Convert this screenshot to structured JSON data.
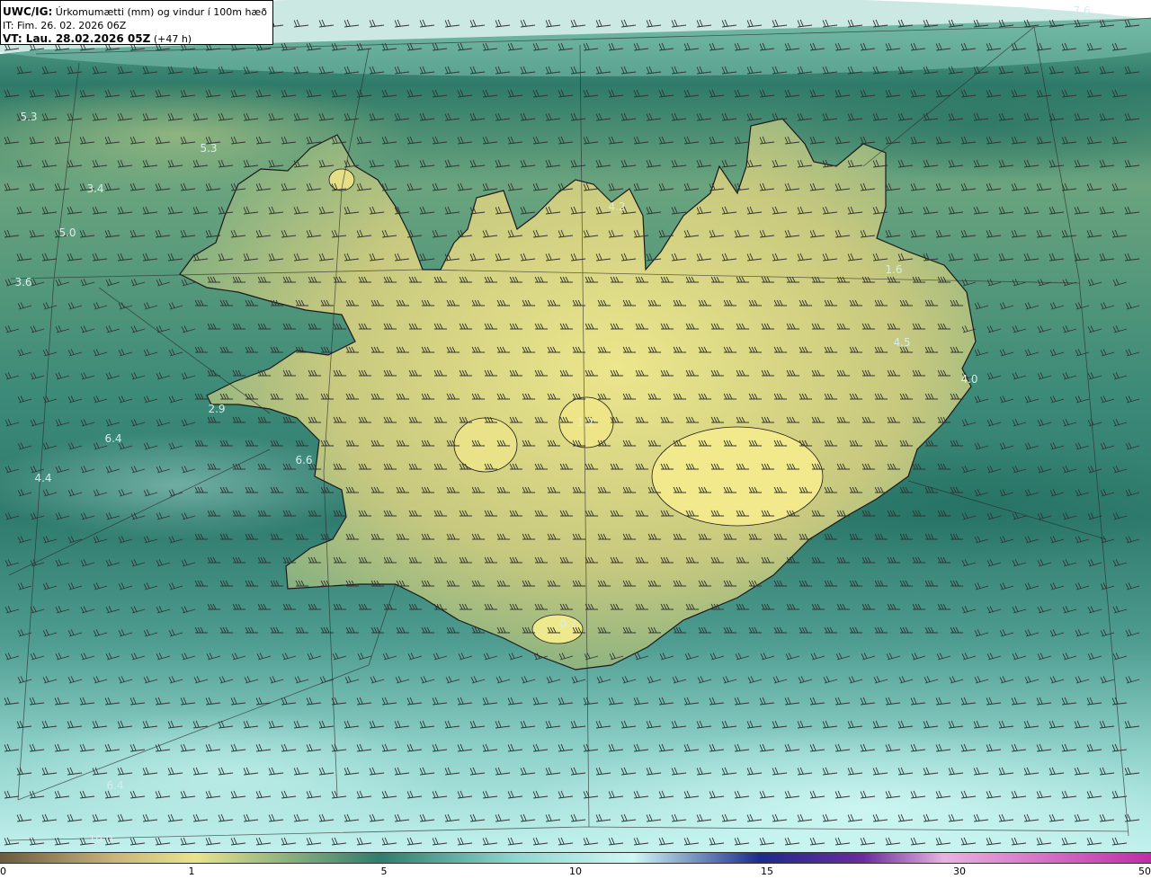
{
  "title": {
    "model": "UWC/IG:",
    "description": "Úrkomumætti (mm) og vindur í 100m hæð",
    "initial_time": "IT: Fim. 26. 02. 2026 06Z",
    "valid_prefix": "VT: Lau. 28.02.2026 05Z",
    "valid_offset": "(+47 h)"
  },
  "map_labels": [
    "7.6",
    "5.3",
    "5.3",
    "3.4",
    "5.0",
    "3.6",
    "2.9",
    "6.4",
    "6.6",
    "4.4",
    "4.2",
    "1.6",
    "4.5",
    "4.0",
    "6.4",
    "10.0",
    "1.2",
    "0.7"
  ],
  "colorbar": {
    "ticks": [
      "0",
      "1",
      "5",
      "10",
      "15",
      "30",
      "50"
    ],
    "colors": {
      "low": "#6b5a3e",
      "tan": "#c9b57a",
      "yellow": "#e8e48c",
      "teal": "#2f7d6e",
      "aqua": "#8fd8cf",
      "light": "#cff6f4",
      "blue": "#1c2c8a",
      "magenta": "#c02ca8"
    }
  },
  "colors": {
    "land": "#d9d68a",
    "sea_dark": "#2f7568",
    "sea_light": "#a9e3dd",
    "coast": "#1a1a1a",
    "barb": "#333333"
  }
}
